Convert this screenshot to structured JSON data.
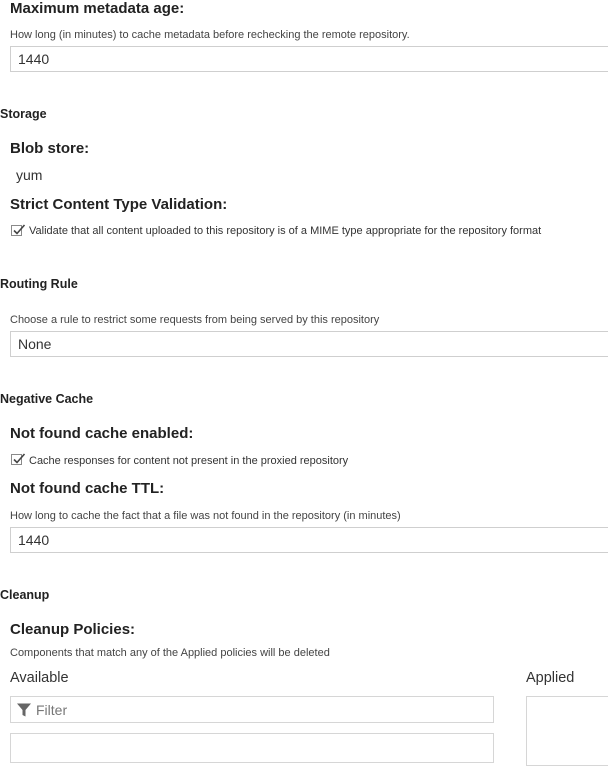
{
  "metadata_age": {
    "label": "Maximum metadata age:",
    "help": "How long (in minutes) to cache metadata before rechecking the remote repository.",
    "value": "1440"
  },
  "storage": {
    "section_title": "Storage",
    "blob_store_label": "Blob store:",
    "blob_store_value": "yum",
    "strict_label": "Strict Content Type Validation:",
    "strict_checkbox_text": "Validate that all content uploaded to this repository is of a MIME type appropriate for the repository format",
    "strict_checked": true
  },
  "routing_rule": {
    "section_title": "Routing Rule",
    "help": "Choose a rule to restrict some requests from being served by this repository",
    "value": "None"
  },
  "negative_cache": {
    "section_title": "Negative Cache",
    "enabled_label": "Not found cache enabled:",
    "enabled_checkbox_text": "Cache responses for content not present in the proxied repository",
    "enabled_checked": true,
    "ttl_label": "Not found cache TTL:",
    "ttl_help": "How long to cache the fact that a file was not found in the repository (in minutes)",
    "ttl_value": "1440"
  },
  "cleanup": {
    "section_title": "Cleanup",
    "policies_label": "Cleanup Policies:",
    "policies_help": "Components that match any of the Applied policies will be deleted",
    "available_label": "Available",
    "applied_label": "Applied",
    "filter_placeholder": "Filter"
  },
  "icons": {
    "checkmark": "checkmark-icon",
    "filter": "filter-icon"
  }
}
